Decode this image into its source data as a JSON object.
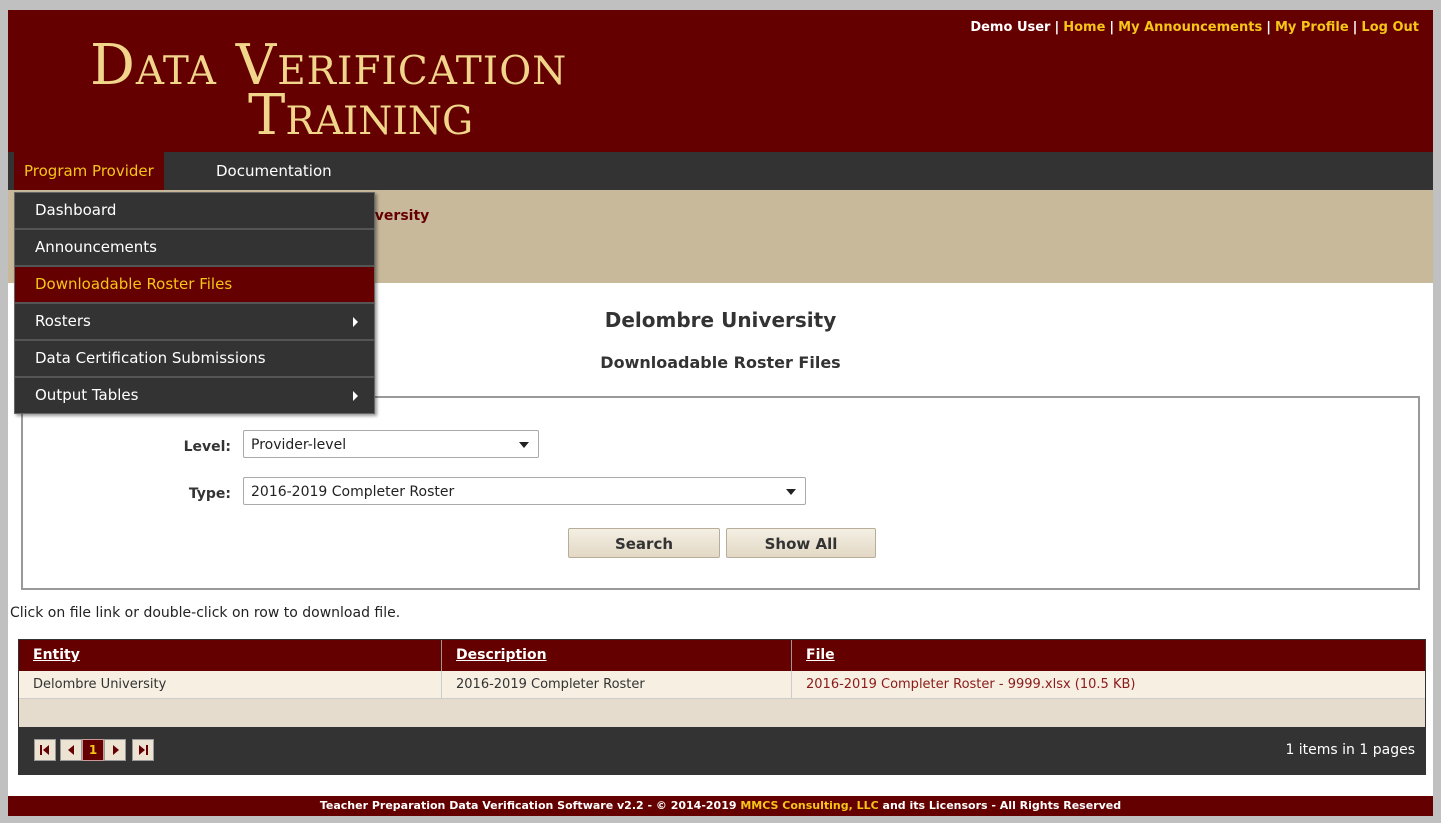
{
  "header": {
    "logo_line1": "Data Verification",
    "logo_line2": "Training",
    "user": "Demo User",
    "links": [
      "Home",
      "My Announcements",
      "My Profile",
      "Log Out"
    ],
    "separator": "|"
  },
  "menubar": {
    "items": [
      "Program Provider",
      "Documentation"
    ]
  },
  "dropdown": {
    "items": [
      {
        "label": "Dashboard"
      },
      {
        "label": "Announcements"
      },
      {
        "label": "Downloadable Roster Files"
      },
      {
        "label": "Rosters"
      },
      {
        "label": "Data Certification Submissions"
      },
      {
        "label": "Output Tables"
      }
    ]
  },
  "breadcrumb": "iversity",
  "page": {
    "title": "Delombre University",
    "subtitle": "Downloadable Roster Files"
  },
  "filters": {
    "level_label": "Level:",
    "level_value": "Provider-level",
    "type_label": "Type:",
    "type_value": "2016-2019 Completer Roster",
    "search_label": "Search",
    "showall_label": "Show All"
  },
  "hint": "Click on file link or double-click on row to download file.",
  "grid": {
    "columns": [
      "Entity",
      "Description",
      "File"
    ],
    "rows": [
      {
        "entity": "Delombre University",
        "description": "2016-2019 Completer Roster",
        "file": "2016-2019 Completer Roster - 9999.xlsx (10.5 KB)"
      }
    ],
    "current_page": "1",
    "page_info": "1 items in 1 pages"
  },
  "footer": {
    "pre": "Teacher Preparation Data Verification Software v2.2 - © 2014-2019 ",
    "company": "MMCS Consulting, LLC",
    "post": " and its Licensors - All Rights Reserved"
  },
  "colors": {
    "maroon": "#650000",
    "gold": "#f5c518",
    "tan": "#c8b99b",
    "dark": "#333333"
  }
}
